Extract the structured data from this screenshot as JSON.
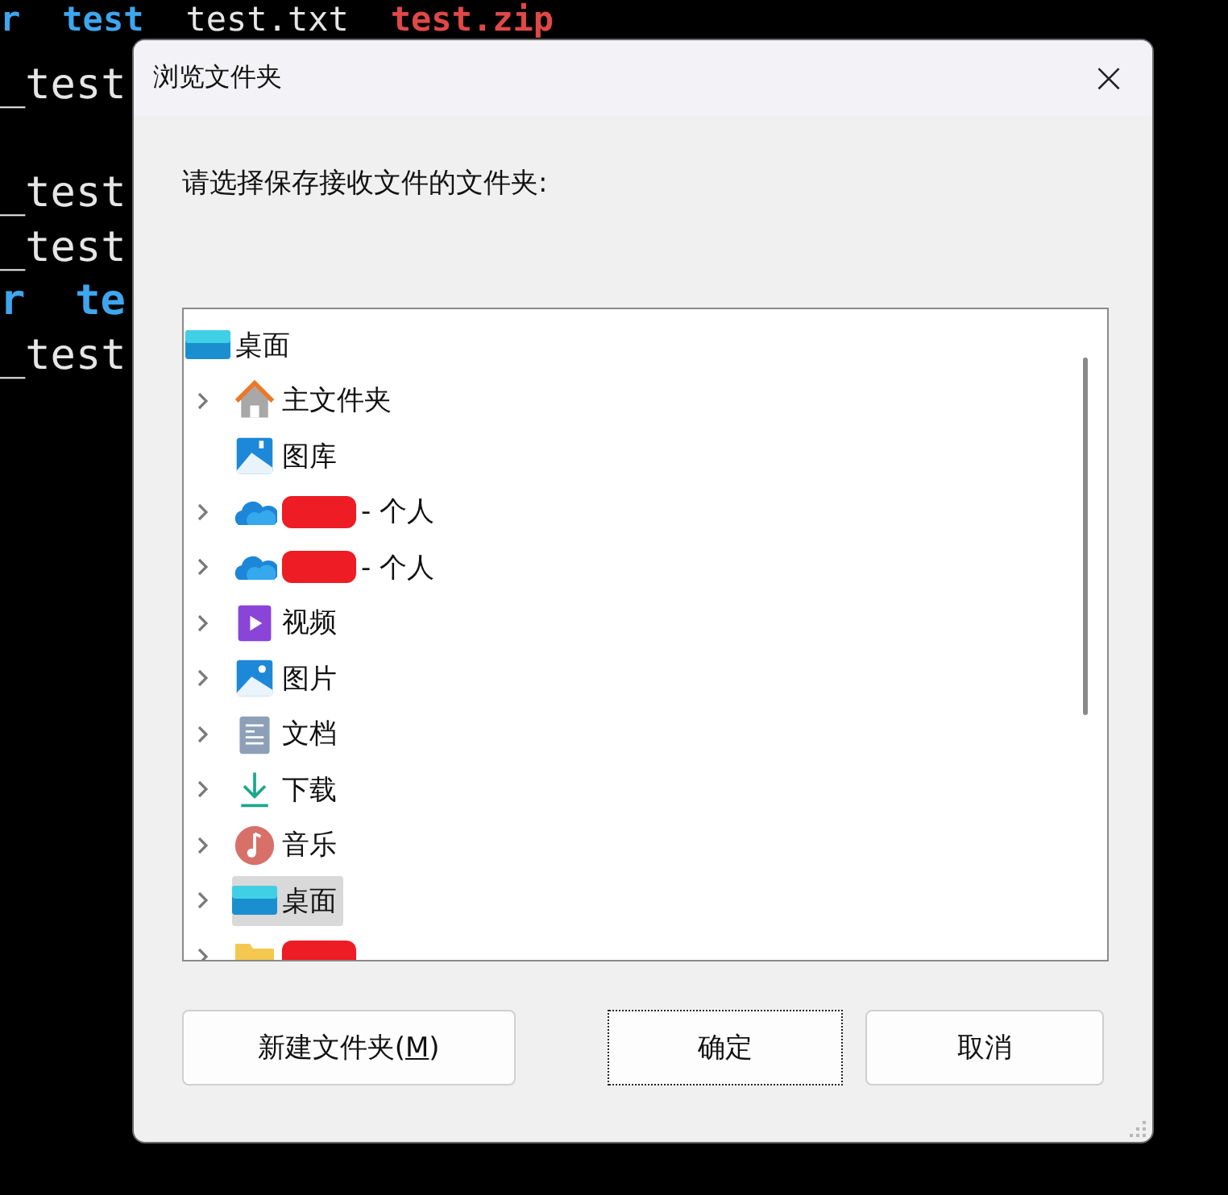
{
  "terminal": {
    "lines": [
      {
        "segments": [
          {
            "text": "r",
            "kind": "dir"
          },
          {
            "text": "test",
            "kind": "dir"
          },
          {
            "text": "test.txt",
            "kind": "file"
          },
          {
            "text": "test.zip",
            "kind": "archive"
          }
        ]
      },
      {
        "segments": [
          {
            "text": "_test",
            "kind": "file"
          }
        ]
      },
      {
        "segments": [
          {
            "text": "_test",
            "kind": "file"
          }
        ]
      },
      {
        "segments": [
          {
            "text": "_test",
            "kind": "file"
          }
        ]
      },
      {
        "segments": [
          {
            "text": "r",
            "kind": "dir"
          },
          {
            "text": "te",
            "kind": "dir"
          }
        ]
      },
      {
        "segments": [
          {
            "text": "_test",
            "kind": "file"
          }
        ]
      }
    ]
  },
  "dialog": {
    "title": "浏览文件夹",
    "close": "×",
    "prompt": "请选择保存接收文件的文件夹:",
    "tree": {
      "label": "桌面",
      "kind": "desktop",
      "selected": false,
      "children": [
        {
          "label": "主文件夹",
          "kind": "home",
          "expandable": true,
          "selected": false,
          "redacted": false
        },
        {
          "label": "图库",
          "kind": "gallery",
          "expandable": false,
          "selected": false,
          "redacted": false
        },
        {
          "label": "- 个人",
          "kind": "cloud",
          "expandable": true,
          "selected": false,
          "redacted": true
        },
        {
          "label": "- 个人",
          "kind": "cloud",
          "expandable": true,
          "selected": false,
          "redacted": true
        },
        {
          "label": "视频",
          "kind": "video",
          "expandable": true,
          "selected": false,
          "redacted": false
        },
        {
          "label": "图片",
          "kind": "picture",
          "expandable": true,
          "selected": false,
          "redacted": false
        },
        {
          "label": "文档",
          "kind": "document",
          "expandable": true,
          "selected": false,
          "redacted": false
        },
        {
          "label": "下载",
          "kind": "download",
          "expandable": true,
          "selected": false,
          "redacted": false
        },
        {
          "label": "音乐",
          "kind": "music",
          "expandable": true,
          "selected": false,
          "redacted": false
        },
        {
          "label": "桌面",
          "kind": "desktop",
          "expandable": true,
          "selected": true,
          "redacted": false
        },
        {
          "kind": "folder",
          "expandable": true,
          "selected": false,
          "redacted": true
        }
      ]
    },
    "buttons": [
      {
        "label": "新建文件夹(",
        "mnemonic": "M",
        "suffix": ")",
        "focused": false
      },
      {
        "label": "确定",
        "focused": true
      },
      {
        "label": "取消",
        "focused": false
      }
    ]
  }
}
